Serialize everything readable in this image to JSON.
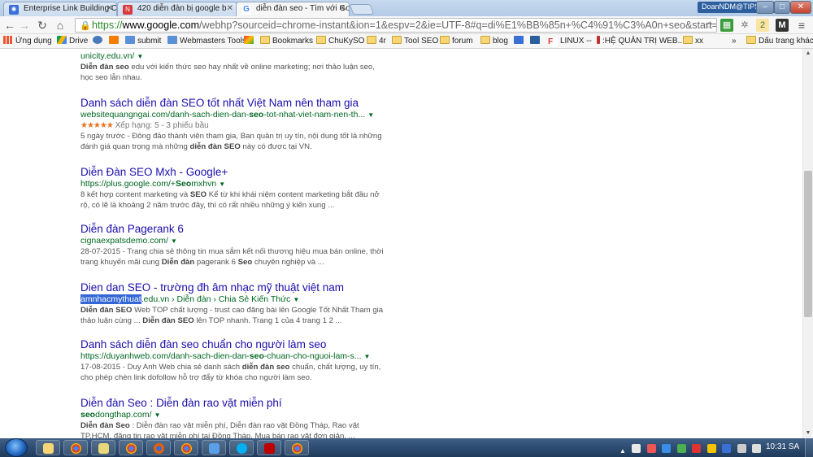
{
  "window": {
    "user_badge": "DoanNDM@TIPS.C...",
    "tabs": [
      {
        "label": "Enterprise Link Building C",
        "icon": "link-icon",
        "color": "#3a6fd8"
      },
      {
        "label": "420 diễn đàn bị google b",
        "icon": "news-icon",
        "color": "#d83a3a"
      },
      {
        "label": "diễn đàn seo - Tìm với Go",
        "icon": "google-icon",
        "color": "#ffffff",
        "active": true
      }
    ]
  },
  "toolbar": {
    "url_scheme": "https://",
    "url_host": "www.google.com",
    "url_rest": "/webhp?sourceid=chrome-instant&ion=1&espv=2&ie=UTF-8#q=di%E1%BB%85n+%C4%91%C3%A0n+seo&start=40"
  },
  "bookmarks": [
    {
      "label": "Ứng dụng",
      "icon": "apps-icon"
    },
    {
      "label": "Drive",
      "icon": "drive-icon"
    },
    {
      "label": "",
      "icon": "chrome-icon"
    },
    {
      "label": "",
      "icon": "blogger-icon"
    },
    {
      "label": "submit",
      "icon": "submit-icon"
    },
    {
      "label": "Webmasters Tools",
      "icon": "webmaster-icon"
    },
    {
      "label": "",
      "icon": "bookmark-color-icon"
    },
    {
      "label": "Bookmarks",
      "icon": "folder-icon"
    },
    {
      "label": "ChuKySO",
      "icon": "folder-icon"
    },
    {
      "label": "4r",
      "icon": "folder-icon"
    },
    {
      "label": "Tool SEO",
      "icon": "folder-icon"
    },
    {
      "label": "forum",
      "icon": "folder-icon"
    },
    {
      "label": "blog",
      "icon": "folder-icon"
    },
    {
      "label": "",
      "icon": "gmail-icon"
    },
    {
      "label": "",
      "icon": "extension-icon"
    },
    {
      "label": "LINUX --",
      "icon": "linux-icon"
    },
    {
      "label": ":HỆ QUẢN TRỊ WEB...",
      "icon": "admin-icon"
    },
    {
      "label": "xx",
      "icon": "folder-icon"
    },
    {
      "label": "»",
      "icon": ""
    },
    {
      "label": "Dấu trang khác",
      "icon": "folder-icon"
    }
  ],
  "results": [
    {
      "title": "",
      "url_pre": "unicity.edu.vn/",
      "url_bold": "",
      "url_post": "",
      "rating": "",
      "snippet_parts": [
        {
          "b": "Diễn đàn seo"
        },
        {
          "t": " edu với kiến thức seo hay nhất về online marketing; nơi thảo luận seo, học seo lẫn nhau."
        }
      ]
    },
    {
      "title": "Danh sách diễn đàn SEO tốt nhất Việt Nam nên tham gia",
      "url_pre": "websitequangngai.com/danh-sach-dien-dan-",
      "url_bold": "seo",
      "url_post": "-tot-nhat-viet-nam-nen-th...",
      "rating_stars": "★★★★★",
      "rating": "Xếp hạng: 5 - 3 phiếu bầu",
      "snippet_parts": [
        {
          "t": "5 ngày trước - Đông đảo thành viên tham gia, Ban quản trị uy tín, nội dung tốt là những đánh giá quan trọng mà những "
        },
        {
          "b": "diễn đàn SEO"
        },
        {
          "t": " này có được tại VN."
        }
      ]
    },
    {
      "title": "Diễn Đàn SEO Mxh - Google+",
      "url_pre": "https://plus.google.com/+",
      "url_bold": "Seo",
      "url_post": "mxhvn",
      "rating": "",
      "snippet_parts": [
        {
          "t": "8 kết hợp content marketing và "
        },
        {
          "b": "SEO"
        },
        {
          "t": " Kể từ khi khái niệm content marketing bắt đầu nở rộ, có lẽ là khoảng 2 năm trước đây, thì có rất nhiều những ý kiến xung ..."
        }
      ]
    },
    {
      "title": "Diễn đàn Pagerank 6",
      "url_pre": "cignaexpatsdemo.com/",
      "url_bold": "",
      "url_post": "",
      "rating": "",
      "snippet_parts": [
        {
          "t": "28-07-2015 - Trang chia sẻ thông tin mua sắm kết nối thương hiệu mua bán online, thời trang khuyến mãi cung "
        },
        {
          "b": "Diễn đàn"
        },
        {
          "t": " pagerank 6 "
        },
        {
          "b": "Seo"
        },
        {
          "t": " chuyên nghiệp và ..."
        }
      ]
    },
    {
      "title": "Dien dan SEO - trường đh âm nhạc mỹ thuật việt nam",
      "url_selected": "amnhacmythuat",
      "url_pre": ".edu.vn › Diễn đàn › Chia Sẻ Kiến Thức",
      "url_bold": "",
      "url_post": "",
      "rating": "",
      "snippet_parts": [
        {
          "b": "Diễn đàn SEO"
        },
        {
          "t": " Web TOP chất lượng - trust cao đăng bài lên Google Tốt Nhất Tham gia thảo luận cùng ... "
        },
        {
          "b": "Diễn đàn SEO"
        },
        {
          "t": " lên TOP nhanh. Trang 1 của 4 trang 1 2 ..."
        }
      ]
    },
    {
      "title": "Danh sách diễn đàn seo chuẩn cho người làm seo",
      "url_pre": "https://duyanhweb.com/danh-sach-dien-dan-",
      "url_bold": "seo",
      "url_post": "-chuan-cho-nguoi-lam-s...",
      "rating": "",
      "snippet_parts": [
        {
          "t": "17-08-2015 - Duy Anh Web chia sẻ danh sách "
        },
        {
          "b": "diễn đàn seo"
        },
        {
          "t": " chuẩn, chất lượng, uy tín, cho phép chèn link dofollow hỗ trợ đẩy từ khóa cho người làm seo."
        }
      ]
    },
    {
      "title": "Diễn đàn Seo : Diễn đàn rao vặt miễn phí",
      "url_pre": "",
      "url_bold": "seo",
      "url_post": "dongthap.com/",
      "rating": "",
      "snippet_parts": [
        {
          "b": "Diễn đàn Seo"
        },
        {
          "t": " : Diễn đàn rao vặt miễn phí, Diễn đàn rao vặt Đồng Tháp, Rao vặt TP.HCM, đăng tin rao vặt miễn phí tại Đồng Tháp. Mua bán rao vặt đơn giản, ..."
        }
      ]
    }
  ],
  "taskbar": {
    "apps": [
      "explorer-icon",
      "chrome-icon",
      "notes-icon",
      "chrome-icon",
      "firefox-icon",
      "chrome-icon",
      "network-icon",
      "skype-icon",
      "filezilla-icon",
      "chrome-icon"
    ],
    "clock": "10:31 SA"
  }
}
